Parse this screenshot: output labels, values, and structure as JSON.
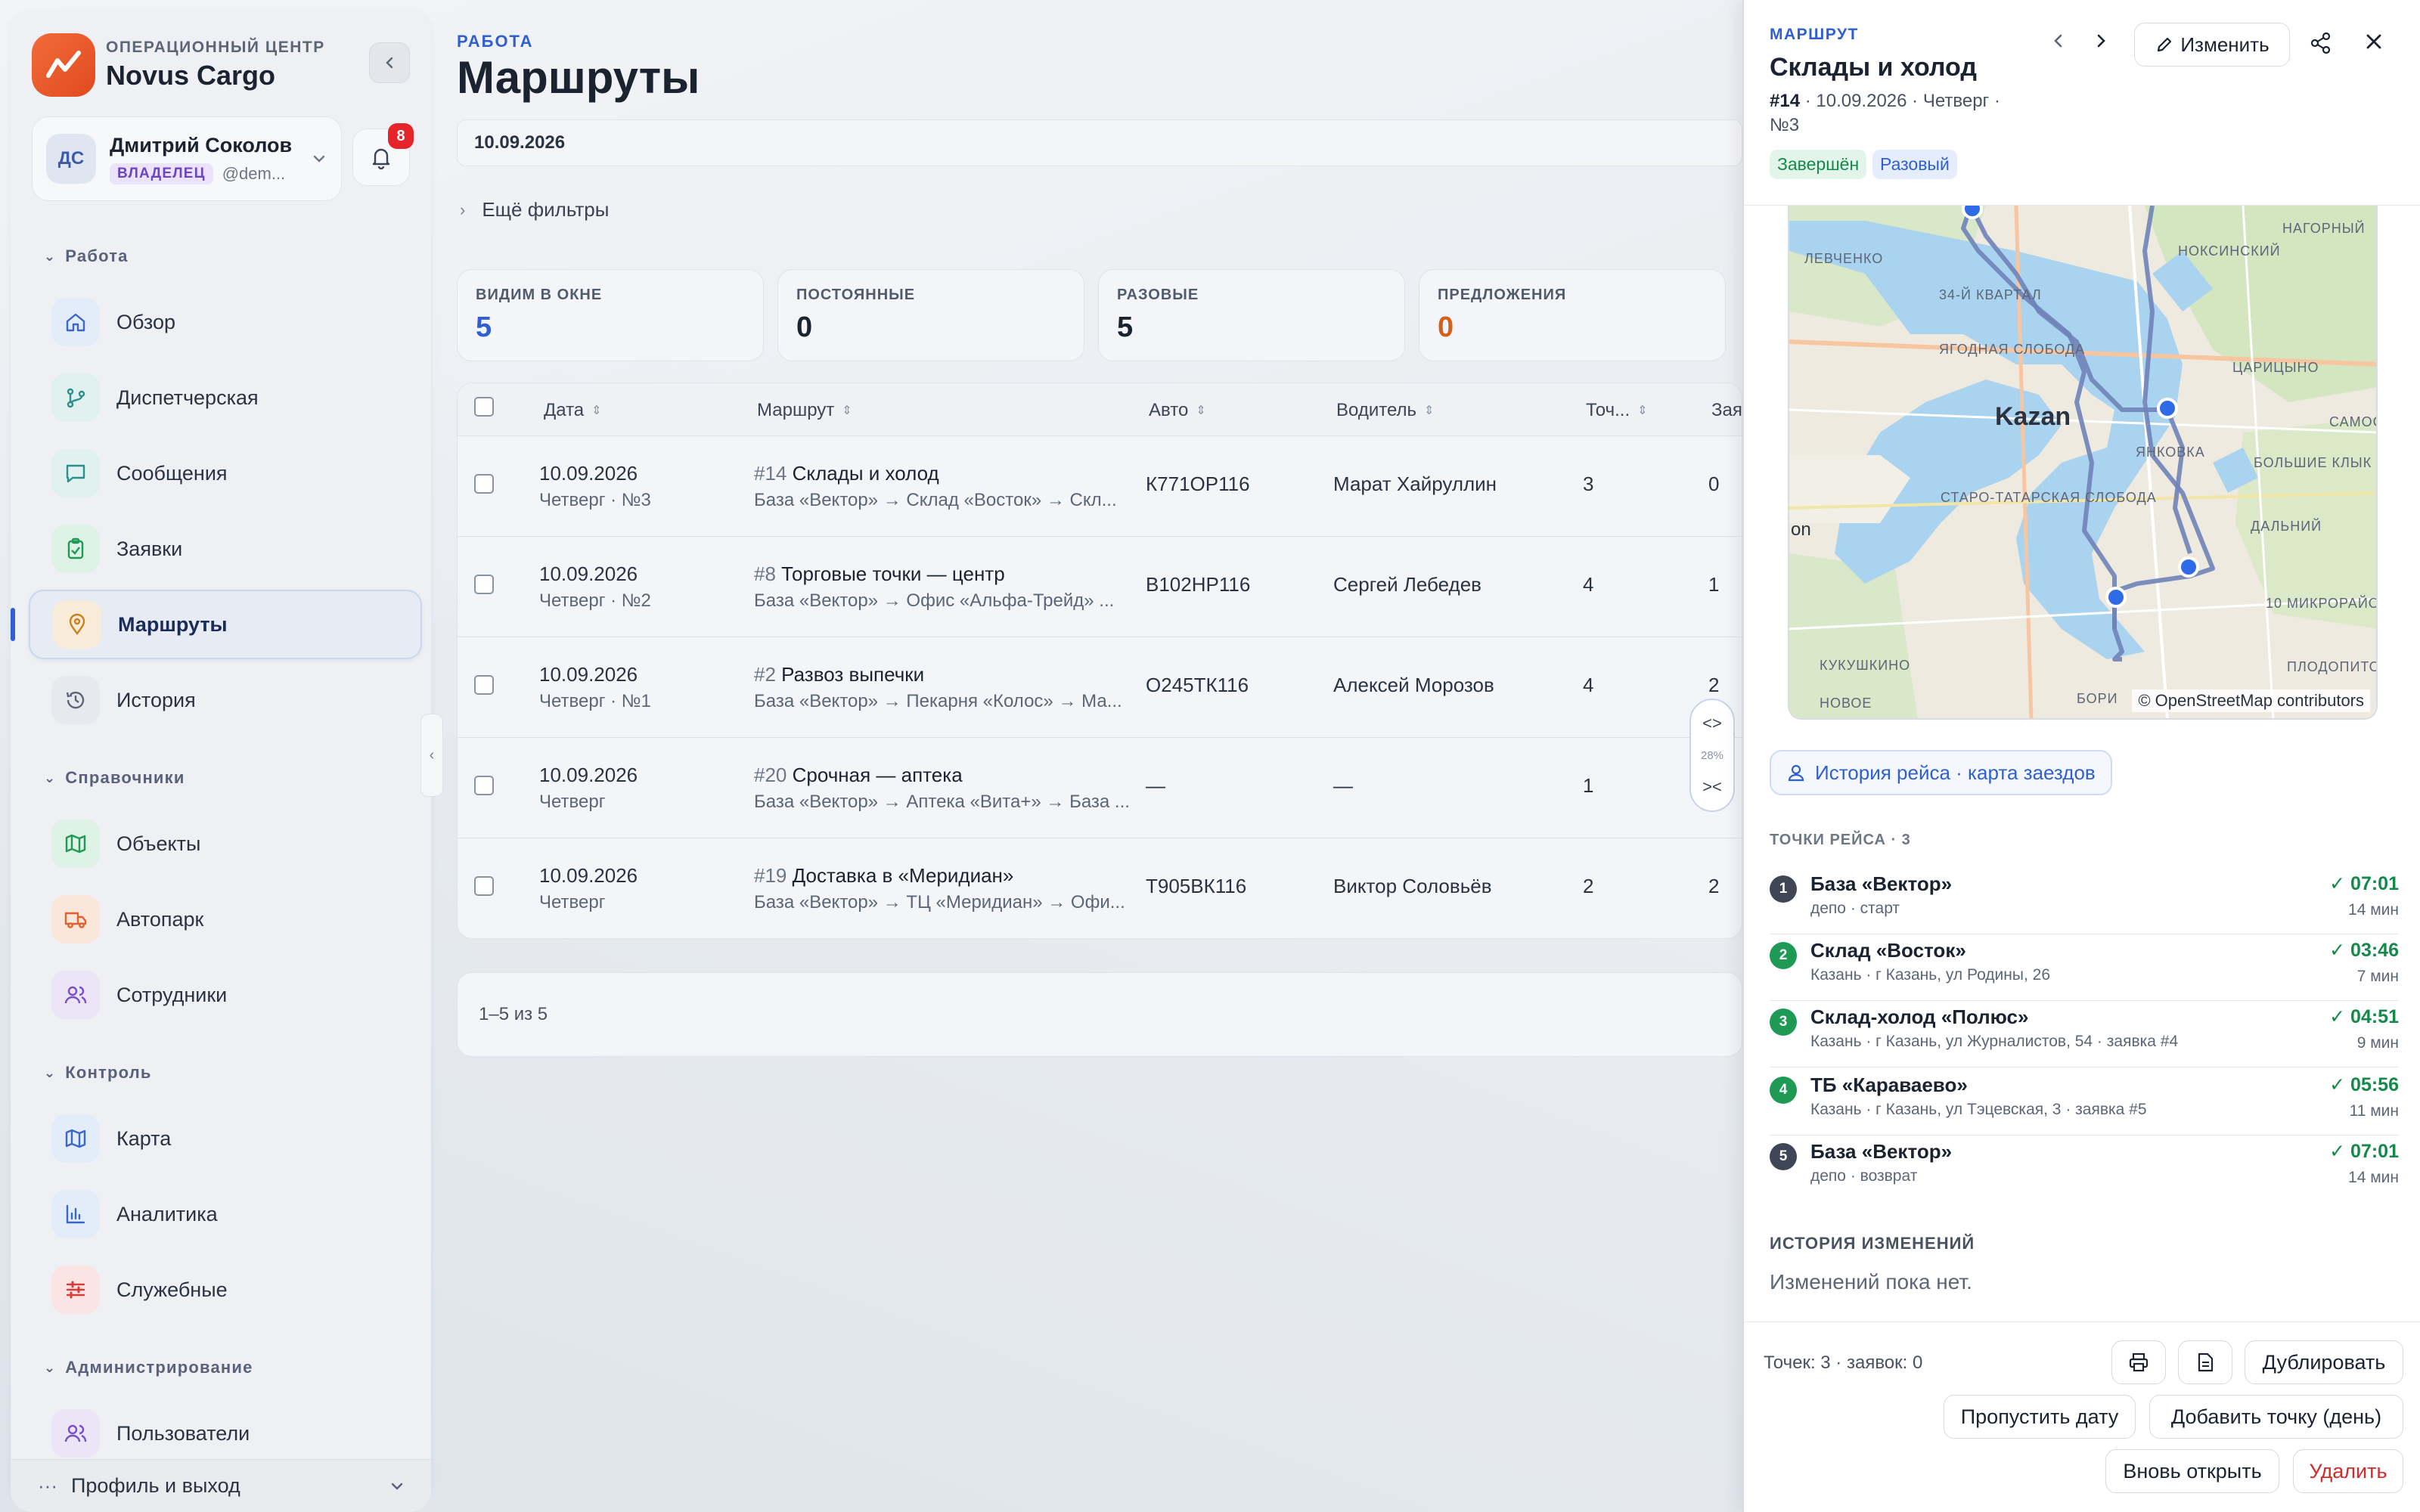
{
  "brand": {
    "subtitle": "ОПЕРАЦИОННЫЙ ЦЕНТР",
    "name": "Novus Cargo",
    "accent": "#e8562a"
  },
  "user": {
    "initials": "ДС",
    "name": "Дмитрий Соколов",
    "role": "ВЛАДЕЛЕЦ",
    "handle": "@dem...",
    "notifications": "8"
  },
  "nav": {
    "sections": [
      {
        "title": "Работа",
        "items": [
          "Обзор",
          "Диспетчерская",
          "Сообщения",
          "Заявки",
          "Маршруты",
          "История"
        ]
      },
      {
        "title": "Справочники",
        "items": [
          "Объекты",
          "Автопарк",
          "Сотрудники"
        ]
      },
      {
        "title": "Контроль",
        "items": [
          "Карта",
          "Аналитика",
          "Служебные"
        ]
      },
      {
        "title": "Администрирование",
        "items": [
          "Пользователи"
        ]
      }
    ],
    "active": "Маршруты",
    "profile_exit": "Профиль и выход"
  },
  "main": {
    "eyebrow": "РАБОТА",
    "title": "Маршруты",
    "date_filter": "10.09.2026",
    "more_filters": "Ещё фильтры",
    "stats": [
      {
        "label": "ВИДИМ В ОКНЕ",
        "value": "5"
      },
      {
        "label": "ПОСТОЯННЫЕ",
        "value": "0"
      },
      {
        "label": "РАЗОВЫЕ",
        "value": "5"
      },
      {
        "label": "ПРЕДЛОЖЕНИЯ",
        "value": "0"
      }
    ],
    "table": {
      "columns": [
        "Дата",
        "Маршрут",
        "Авто",
        "Водитель",
        "Точ...",
        "Зая"
      ],
      "rows": [
        {
          "date": "10.09.2026",
          "date_sub": "Четверг · №3",
          "num": "#14",
          "name": "Склады и холод",
          "path": "База «Вектор» → Склад «Восток» → Скл...",
          "car": "К771ОР116",
          "driver": "Марат Хайруллин",
          "points": "3",
          "orders": "0"
        },
        {
          "date": "10.09.2026",
          "date_sub": "Четверг · №2",
          "num": "#8",
          "name": "Торговые точки — центр",
          "path": "База «Вектор» → Офис «Альфа-Трейд» ...",
          "car": "В102НР116",
          "driver": "Сергей Лебедев",
          "points": "4",
          "orders": "1"
        },
        {
          "date": "10.09.2026",
          "date_sub": "Четверг · №1",
          "num": "#2",
          "name": "Развоз выпечки",
          "path": "База «Вектор» → Пекарня «Колос» → Ма...",
          "car": "О245ТК116",
          "driver": "Алексей Морозов",
          "points": "4",
          "orders": "2"
        },
        {
          "date": "10.09.2026",
          "date_sub": "Четверг",
          "num": "#20",
          "name": "Срочная — аптека",
          "path": "База «Вектор» → Аптека «Вита+» → База ...",
          "car": "—",
          "driver": "—",
          "points": "1",
          "orders": ""
        },
        {
          "date": "10.09.2026",
          "date_sub": "Четверг",
          "num": "#19",
          "name": "Доставка в «Меридиан»",
          "path": "База «Вектор» → ТЦ «Меридиан» → Офи...",
          "car": "Т905ВК116",
          "driver": "Виктор Соловьёв",
          "points": "2",
          "orders": "2"
        }
      ]
    },
    "pager": "1–5 из 5",
    "zoom": "28%"
  },
  "panel": {
    "eyebrow": "МАРШРУТ",
    "title": "Склады и холод",
    "meta_num": "#14",
    "meta_rest": " · 10.09.2026 · Четверг · №3",
    "status": "Завершён",
    "type": "Разовый",
    "edit_label": "Изменить",
    "map": {
      "city": "Kazan",
      "attribution": "© OpenStreetMap contributors",
      "labels": [
        "ЛЕВЧЕНКО",
        "34-Й КВАРТАЛ",
        "ЯГОДНАЯ СЛОБОДА",
        "НОКСИНСКИЙ",
        "НАГОРНЫЙ",
        "ЦАРИЦЫНО",
        "САМОС",
        "ЯНКОВКА",
        "БОЛЬШИЕ КЛЫК",
        "СТАРО-ТАТАРСКАЯ СЛОБОДА",
        "ДАЛЬНИЙ",
        "10 МИКРОРАЙО",
        "КУКУШКИНО",
        "ПЛОДОПИТОМН",
        "НОВОЕ",
        "БОРИ",
        "on"
      ]
    },
    "history_link": "История рейса · карта заездов",
    "stops_label": "ТОЧКИ РЕЙСА · 3",
    "stops": [
      {
        "n": "1",
        "name": "База «Вектор»",
        "addr": "депо · старт",
        "time": "✓ 07:01",
        "dur": "14 мин",
        "color": "#3f4656"
      },
      {
        "n": "2",
        "name": "Склад «Восток»",
        "addr": "Казань · г Казань, ул Родины, 26",
        "time": "✓ 03:46",
        "dur": "7 мин",
        "color": "#1f9a55"
      },
      {
        "n": "3",
        "name": "Склад-холод «Полюс»",
        "addr": "Казань · г Казань, ул Журналистов, 54 · заявка #4",
        "time": "✓ 04:51",
        "dur": "9 мин",
        "color": "#1f9a55"
      },
      {
        "n": "4",
        "name": "ТБ «Караваево»",
        "addr": "Казань · г Казань, ул Тэцевская, 3 · заявка #5",
        "time": "✓ 05:56",
        "dur": "11 мин",
        "color": "#1f9a55"
      },
      {
        "n": "5",
        "name": "База «Вектор»",
        "addr": "депо · возврат",
        "time": "✓ 07:01",
        "dur": "14 мин",
        "color": "#3f4656"
      }
    ],
    "changes_label": "ИСТОРИЯ ИЗМЕНЕНИЙ",
    "changes_empty": "Изменений пока нет.",
    "footer": {
      "count": "Точек: 3 · заявок: 0",
      "duplicate": "Дублировать",
      "skip_date": "Пропустить дату",
      "add_point": "Добавить точку (день)",
      "reopen": "Вновь открыть",
      "delete": "Удалить"
    }
  }
}
